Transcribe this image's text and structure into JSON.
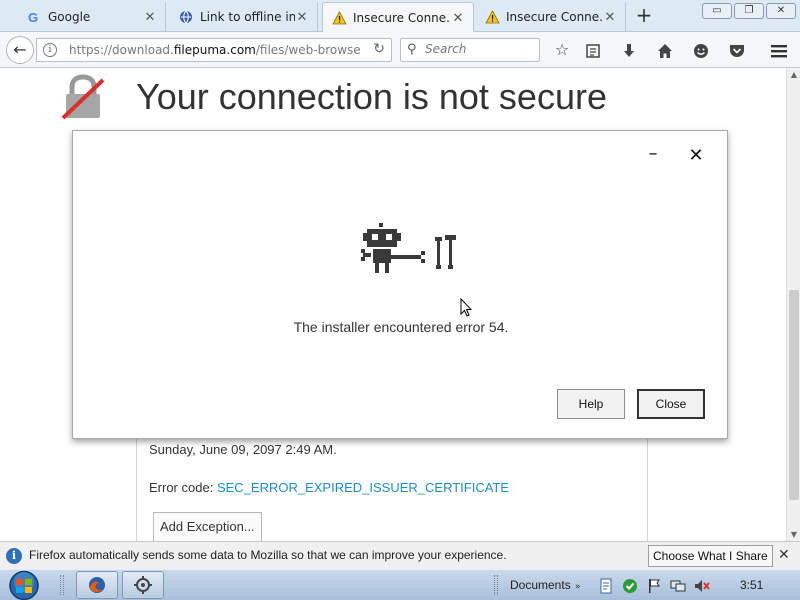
{
  "tabs": [
    {
      "label": "Google",
      "icon": "google-g-icon",
      "state": "inactive"
    },
    {
      "label": "Link to offline in...",
      "icon": "globe-icon",
      "state": "inactive"
    },
    {
      "label": "Insecure Conne...",
      "icon": "warning-triangle-icon",
      "state": "active"
    },
    {
      "label": "Insecure Conne...",
      "icon": "warning-triangle-icon",
      "state": "inactive"
    }
  ],
  "window_controls": {
    "minimize": "▭",
    "restore": "❐",
    "close": "✕"
  },
  "urlbar": {
    "prefix": "https://download.",
    "domain": "filepuma.com",
    "path": "/files/web-browse"
  },
  "search": {
    "placeholder": "Search"
  },
  "page": {
    "title": "Your connection is not secure",
    "details_date": "Sunday, June 09, 2097 2:49 AM.",
    "error_code_label": "Error code:",
    "error_code": "SEC_ERROR_EXPIRED_ISSUER_CERTIFICATE",
    "add_exception": "Add Exception..."
  },
  "dialog": {
    "message": "The installer encountered error 54.",
    "help": "Help",
    "close": "Close"
  },
  "notification": {
    "text": "Firefox automatically sends some data to Mozilla so that we can improve your experience.",
    "button": "Choose What I Share"
  },
  "taskbar": {
    "documents": "Documents",
    "clock": "3:51"
  },
  "colors": {
    "link": "#1e8bc3",
    "lock_slash": "#d9302c",
    "notification_icon": "#2f6fb5"
  }
}
